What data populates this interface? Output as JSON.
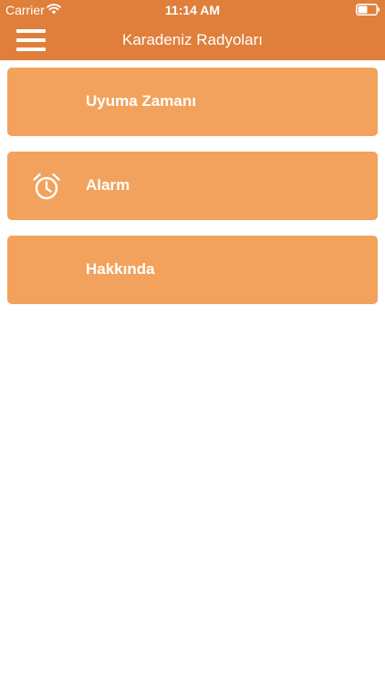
{
  "status_bar": {
    "carrier": "Carrier",
    "time": "11:14 AM"
  },
  "nav": {
    "title": "Karadeniz Radyoları",
    "menu_icon": "hamburger-menu-icon"
  },
  "menu": {
    "items": [
      {
        "label": "Uyuma Zamanı",
        "icon": ""
      },
      {
        "label": "Alarm",
        "icon": "alarm-clock-icon"
      },
      {
        "label": "Hakkında",
        "icon": ""
      }
    ]
  },
  "colors": {
    "header": "#df7f3b",
    "item_background": "#f2a25c",
    "text": "#ffffff",
    "page_background": "#ffffff"
  }
}
